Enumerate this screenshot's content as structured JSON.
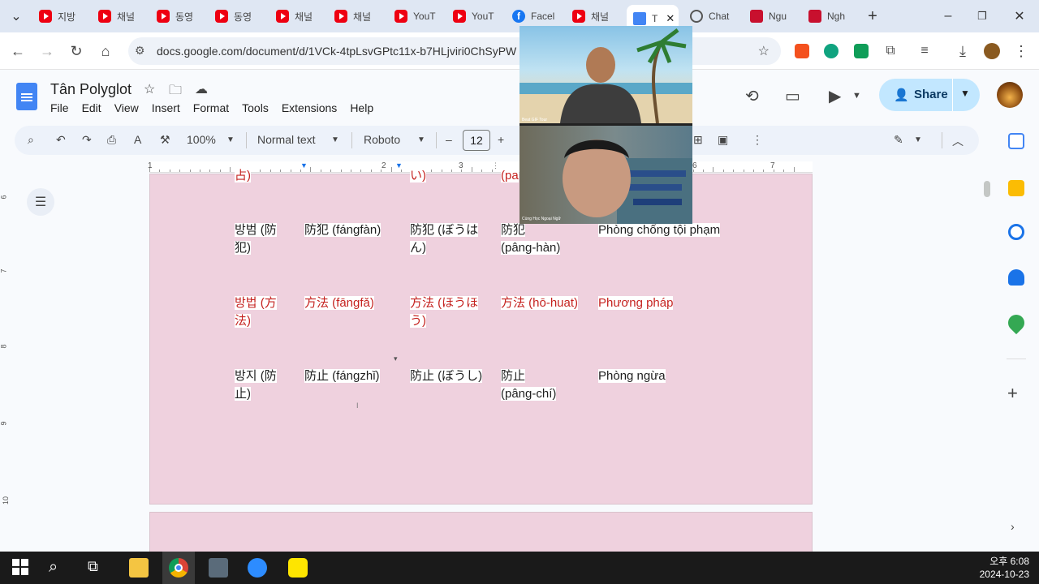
{
  "browser": {
    "tabs": [
      {
        "label": "지방",
        "icon": "youtube-icon"
      },
      {
        "label": "채널",
        "icon": "youtube-icon"
      },
      {
        "label": "동영",
        "icon": "youtube-icon"
      },
      {
        "label": "동영",
        "icon": "youtube-icon"
      },
      {
        "label": "채널",
        "icon": "youtube-icon"
      },
      {
        "label": "채널",
        "icon": "youtube-icon"
      },
      {
        "label": "YouT",
        "icon": "youtube-icon"
      },
      {
        "label": "YouT",
        "icon": "youtube-icon"
      },
      {
        "label": "Facel",
        "icon": "facebook-icon"
      },
      {
        "label": "채널",
        "icon": "youtube-icon"
      },
      {
        "label": "T",
        "icon": "google-docs-icon",
        "active": true
      },
      {
        "label": "Chat",
        "icon": "chatgpt-icon"
      },
      {
        "label": "Ngu",
        "icon": "book-icon"
      },
      {
        "label": "Ngh",
        "icon": "book-icon"
      }
    ],
    "url": "docs.google.com/document/d/1VCk-4tpLsvGPtc11x-b7HLjviri0ChSyPW"
  },
  "doc": {
    "title": "Tân Polyglot",
    "menus": [
      "File",
      "Edit",
      "View",
      "Insert",
      "Format",
      "Tools",
      "Extensions",
      "Help"
    ],
    "share_label": "Share",
    "toolbar": {
      "zoom": "100%",
      "style": "Normal text",
      "font": "Roboto",
      "font_size": "12"
    },
    "ruler_numbers": [
      "1",
      "2",
      "3",
      "4",
      "5",
      "6",
      "7"
    ],
    "vruler_numbers": [
      "6",
      "7",
      "8",
      "9",
      "10"
    ],
    "rows": [
      {
        "cells": [
          "占)",
          "",
          "い)",
          "(pa",
          ""
        ],
        "color": "red"
      },
      {
        "cells": [
          "방범 (防\n犯)",
          "防犯 (fángfàn)",
          "防犯 (ぼうは\nん)",
          "防犯\n(pâng-hàn)",
          "Phòng chống tội phạm"
        ],
        "color": "black"
      },
      {
        "cells": [
          "방법 (方\n法)",
          "方法 (fāngfǎ)",
          "方法 (ほうほ\nう)",
          "方法 (hō-huat)",
          "Phương pháp"
        ],
        "color": "red"
      },
      {
        "cells": [
          "방지 (防\n止)",
          "防止 (fángzhǐ)",
          "防止 (ぼうし)",
          "防止\n(pâng-chí)",
          "Phòng ngừa"
        ],
        "color": "black"
      }
    ]
  },
  "video": {
    "top_name": "Beat GIF Tour",
    "bottom_name": "Cùng Học Ngoại Ngữ"
  },
  "taskbar": {
    "time": "오후 6:08",
    "date": "2024-10-23"
  }
}
